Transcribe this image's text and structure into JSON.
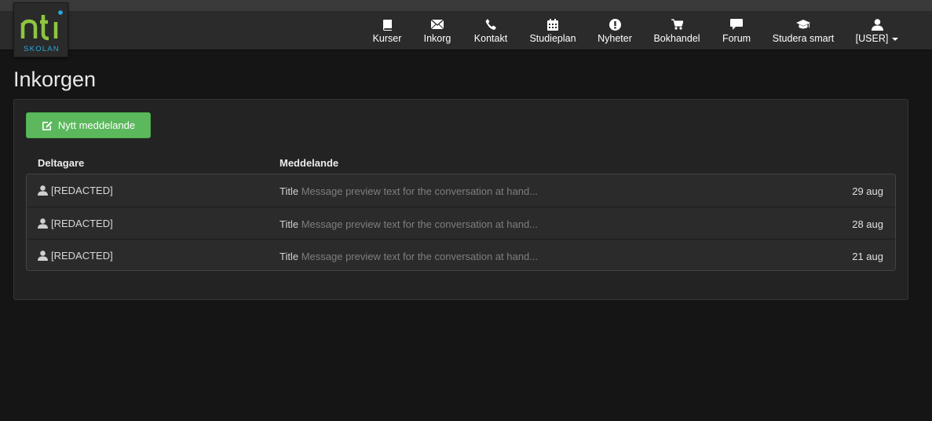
{
  "logo": {
    "wordmark": "nti",
    "subtitle": "SKOLAN",
    "color": "#8dc63f",
    "dot_color": "#29a9e0"
  },
  "nav": {
    "items": [
      {
        "label": "Kurser",
        "icon": "book-icon"
      },
      {
        "label": "Inkorg",
        "icon": "envelope-icon"
      },
      {
        "label": "Kontakt",
        "icon": "phone-icon"
      },
      {
        "label": "Studieplan",
        "icon": "calendar-icon"
      },
      {
        "label": "Nyheter",
        "icon": "exclamation-icon"
      },
      {
        "label": "Bokhandel",
        "icon": "cart-icon"
      },
      {
        "label": "Forum",
        "icon": "speech-bubble-icon"
      },
      {
        "label": "Studera smart",
        "icon": "graduation-cap-icon"
      },
      {
        "label": "[USER]",
        "icon": "user-icon"
      }
    ]
  },
  "page": {
    "title": "Inkorgen"
  },
  "actions": {
    "new_message": "Nytt meddelande"
  },
  "table": {
    "headers": {
      "participant": "Deltagare",
      "message": "Meddelande"
    },
    "rows": [
      {
        "participant": "[REDACTED]",
        "title": "Title",
        "preview": "Message preview text for the conversation at hand...",
        "date": "29 aug"
      },
      {
        "participant": "[REDACTED]",
        "title": "Title",
        "preview": "Message preview text for the conversation at hand...",
        "date": "28 aug"
      },
      {
        "participant": "[REDACTED]",
        "title": "Title",
        "preview": "Message preview text for the conversation at hand...",
        "date": "21 aug"
      }
    ]
  },
  "colors": {
    "accent_green": "#5cb85c",
    "background": "#151515",
    "navbar": "#2b2b2b"
  }
}
